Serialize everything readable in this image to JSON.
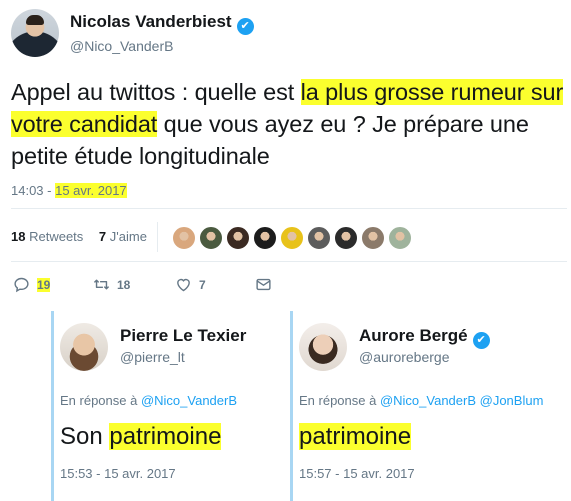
{
  "tweet": {
    "author_name": "Nicolas Vanderbiest",
    "author_handle": "@Nico_VanderB",
    "verified_icon": "✔",
    "text_parts": [
      "Appel au twittos : quelle est ",
      "la plus grosse rumeur sur votre candidat",
      " que vous ayez eu ? Je prépare une petite étude longitudinale"
    ],
    "time": "14:03 - ",
    "date": "15 avr. 2017"
  },
  "stats": {
    "retweets_count": "18",
    "retweets_label": "Retweets",
    "likes_count": "7",
    "likes_label": "J'aime",
    "liker_avatars": [
      {
        "color": "#d9a77d"
      },
      {
        "color": "#4a5a3f"
      },
      {
        "color": "#3b2a22"
      },
      {
        "color": "#1c1c1c"
      },
      {
        "color": "#e8c21a"
      },
      {
        "color": "#5c5c5c"
      },
      {
        "color": "#2b2b2b"
      },
      {
        "color": "#8b7a6a"
      },
      {
        "color": "#9fb39c"
      }
    ]
  },
  "actions": {
    "reply_icon": "reply-icon",
    "reply_count": "19",
    "retweet_icon": "retweet-icon",
    "retweet_count": "18",
    "like_icon": "heart-icon",
    "like_count": "7",
    "dm_icon": "envelope-icon"
  },
  "replies": [
    {
      "name": "Pierre Le Texier",
      "handle": "@pierre_lt",
      "in_reply_prefix": "En réponse à ",
      "mentions": "@Nico_VanderB",
      "body_prefix": "Son ",
      "body_highlight": "patrimoine",
      "time": "15:53 - 15 avr. 2017"
    },
    {
      "name": "Aurore Bergé",
      "handle": "@auroreberge",
      "verified_icon": "✔",
      "in_reply_prefix": "En réponse à ",
      "mentions": "@Nico_VanderB @JonBlum",
      "body_prefix": "",
      "body_highlight": "patrimoine",
      "time": "15:57 - 15 avr. 2017"
    }
  ],
  "colors": {
    "highlight": "#fbff2e",
    "link": "#1da1f2",
    "muted": "#657786",
    "thread_bar": "#a8d6f3"
  }
}
